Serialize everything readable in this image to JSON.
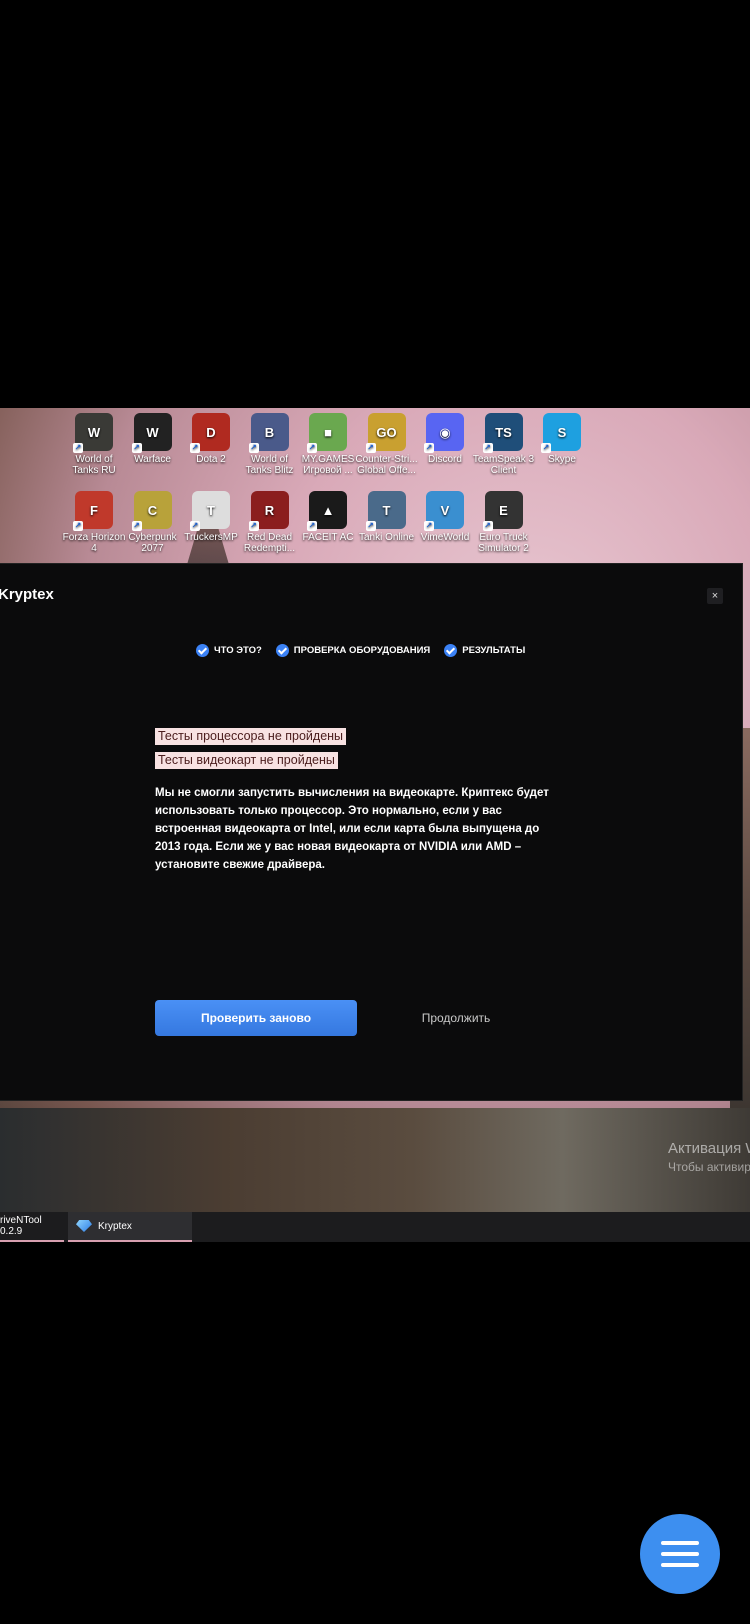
{
  "desktop_icons_row1": [
    {
      "label": "World of Tanks RU",
      "icon": "world-of-tanks-icon",
      "color": "#3a3a36",
      "glyph": "W"
    },
    {
      "label": "Warface",
      "icon": "warface-icon",
      "color": "#222",
      "glyph": "W"
    },
    {
      "label": "Dota 2",
      "icon": "dota-icon",
      "color": "#b02a20",
      "glyph": "D"
    },
    {
      "label": "World of Tanks Blitz",
      "icon": "wot-blitz-icon",
      "color": "#4a5a8a",
      "glyph": "B"
    },
    {
      "label": "MY.GAMES Игровой ...",
      "icon": "mygames-icon",
      "color": "#6aa84f",
      "glyph": "■"
    },
    {
      "label": "Counter-Stri... Global Offe...",
      "icon": "csgo-icon",
      "color": "#c9a030",
      "glyph": "GO"
    },
    {
      "label": "Discord",
      "icon": "discord-icon",
      "color": "#5865f2",
      "glyph": "◉"
    },
    {
      "label": "TeamSpeak 3 Client",
      "icon": "teamspeak-icon",
      "color": "#1f4e79",
      "glyph": "TS"
    },
    {
      "label": "Skype",
      "icon": "skype-icon",
      "color": "#1ea0e0",
      "glyph": "S"
    }
  ],
  "desktop_icons_row2": [
    {
      "label": "Forza Horizon 4",
      "icon": "forza-icon",
      "color": "#c0392b",
      "glyph": "F"
    },
    {
      "label": "Cyberpunk 2077",
      "icon": "cyberpunk-icon",
      "color": "#b8a23a",
      "glyph": "C"
    },
    {
      "label": "TruckersMP",
      "icon": "truckersmp-icon",
      "color": "#ddd",
      "glyph": "T"
    },
    {
      "label": "Red Dead Redempti...",
      "icon": "rdr-icon",
      "color": "#8b1e1e",
      "glyph": "R"
    },
    {
      "label": "FACEIT AC",
      "icon": "faceit-icon",
      "color": "#1a1a1a",
      "glyph": "▲"
    },
    {
      "label": "Tanki Online",
      "icon": "tanki-icon",
      "color": "#4a6a8a",
      "glyph": "T"
    },
    {
      "label": "VimeWorld",
      "icon": "vimeworld-icon",
      "color": "#3a8fd0",
      "glyph": "V"
    },
    {
      "label": "Euro Truck Simulator 2",
      "icon": "ets2-icon",
      "color": "#333",
      "glyph": "E"
    }
  ],
  "modal": {
    "title": "Kryptex",
    "close": "×",
    "steps": [
      {
        "label": "ЧТО ЭТО?"
      },
      {
        "label": "ПРОВЕРКА ОБОРУДОВАНИЯ"
      },
      {
        "label": "РЕЗУЛЬТАТЫ"
      }
    ],
    "error_cpu": "Тесты процессора не пройдены",
    "error_gpu": "Тесты видеокарт не пройдены",
    "description": "Мы не смогли запустить вычисления на видеокарте. Криптекс будет использовать только процессор. Это нормально, если у вас встроенная видеокарта от Intel, или если карта была выпущена до 2013 года. Если же у вас новая видеокарта от NVIDIA или AMD – установите свежие драйвера.",
    "retry_button": "Проверить заново",
    "continue_button": "Продолжить"
  },
  "watermark": {
    "title": "Активация W",
    "subtitle": "Чтобы активир"
  },
  "taskbar": {
    "items": [
      {
        "label": "riveNTool 0.2.9"
      },
      {
        "label": "Kryptex"
      }
    ]
  }
}
